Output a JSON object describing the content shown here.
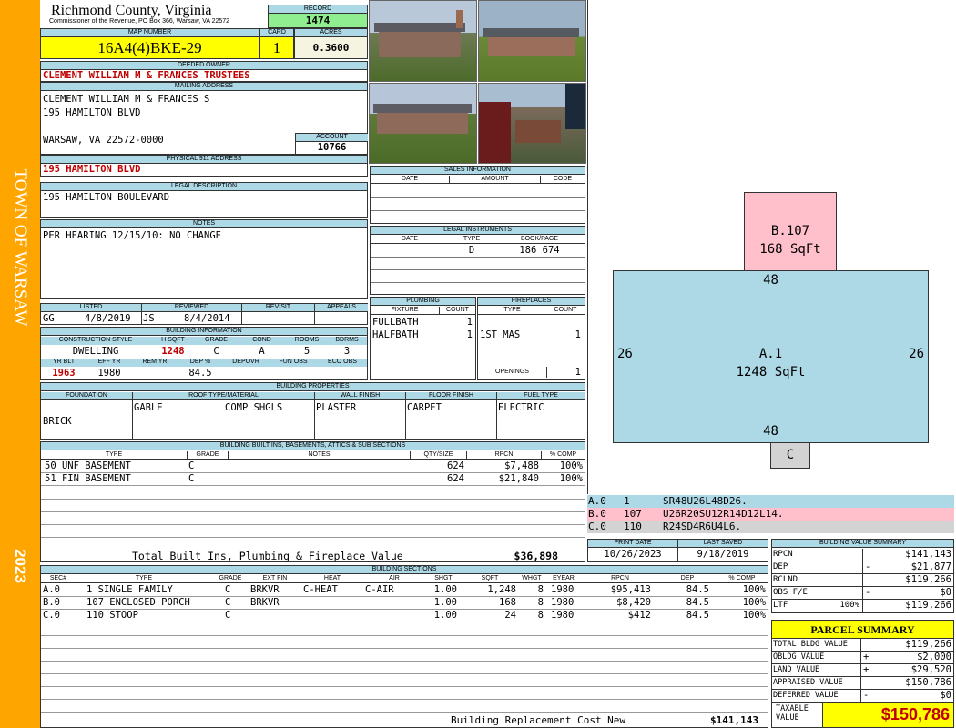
{
  "sidebar": {
    "town": "TOWN OF WARSAW",
    "year": "2023"
  },
  "header": {
    "county": "Richmond County, Virginia",
    "commissioner": "Commissioner of the Revenue, PO Box 366, Warsaw, VA 22572",
    "record_label": "RECORD",
    "record": "1474",
    "map_label": "MAP NUMBER",
    "map_number": "16A4(4)BKE-29",
    "card_label": "CARD",
    "card": "1",
    "acres_label": "ACRES",
    "acres": "0.3600"
  },
  "owner": {
    "deeded_label": "DEEDED OWNER",
    "deeded": "CLEMENT WILLIAM M & FRANCES TRUSTEES",
    "mailing_label": "MAILING ADDRESS",
    "mail1": "CLEMENT WILLIAM M & FRANCES S",
    "mail2": "195 HAMILTON BLVD",
    "mail3": "WARSAW, VA 22572-0000",
    "account_label": "ACCOUNT",
    "account": "10766",
    "physical_label": "PHYSICAL 911 ADDRESS",
    "physical": "195 HAMILTON BLVD",
    "legal_label": "LEGAL DESCRIPTION",
    "legal": "195 HAMILTON BOULEVARD",
    "notes_label": "NOTES",
    "notes": "PER HEARING 12/15/10: NO CHANGE"
  },
  "review": {
    "listed_label": "LISTED",
    "reviewed_label": "REVIEWED",
    "revisit_label": "REVISIT",
    "appeals_label": "APPEALS",
    "listed_by": "GG",
    "listed_date": "4/8/2019",
    "reviewed_by": "JS",
    "reviewed_date": "8/4/2014"
  },
  "building_info": {
    "title": "BUILDING INFORMATION",
    "h1": [
      "CONSTRUCTION STYLE",
      "H SQFT",
      "GRADE",
      "COND",
      "ROOMS",
      "BDRMS"
    ],
    "v1": [
      "DWELLING",
      "1248",
      "C",
      "A",
      "5",
      "3"
    ],
    "h2": [
      "YR BLT",
      "EFF YR",
      "REM YR",
      "DEP %",
      "DEPOVR",
      "FUN OBS",
      "ECO OBS"
    ],
    "v2": [
      "1963",
      "1980",
      "",
      "84.5",
      "",
      "",
      ""
    ]
  },
  "sales": {
    "title": "SALES INFORMATION",
    "headers": [
      "DATE",
      "AMOUNT",
      "CODE"
    ]
  },
  "legal_instruments": {
    "title": "LEGAL INSTRUMENTS",
    "headers": [
      "DATE",
      "TYPE",
      "BOOK/PAGE"
    ],
    "type": "D",
    "bookpage": "186 674"
  },
  "plumbing": {
    "title": "PLUMBING",
    "headers": [
      "FIXTURE",
      "COUNT"
    ],
    "rows": [
      [
        "FULLBATH",
        "1"
      ],
      [
        "HALFBATH",
        "1"
      ]
    ]
  },
  "fireplaces": {
    "title": "FIREPLACES",
    "headers": [
      "TYPE",
      "COUNT"
    ],
    "rows": [
      [
        "1ST MAS",
        "1"
      ]
    ],
    "openings_label": "OPENINGS",
    "openings": "1"
  },
  "properties": {
    "title": "BUILDING PROPERTIES",
    "headers": [
      "FOUNDATION",
      "ROOF TYPE/MATERIAL",
      "WALL FINISH",
      "FLOOR FINISH",
      "FUEL TYPE"
    ],
    "foundation": "BRICK",
    "roof_type": "GABLE",
    "roof_material": "COMP SHGLS",
    "wall": "PLASTER",
    "floor": "CARPET",
    "fuel": "ELECTRIC"
  },
  "builtins": {
    "title": "BUILDING BUILT INS, BASEMENTS, ATTICS & SUB SECTIONS",
    "headers": [
      "TYPE",
      "GRADE",
      "NOTES",
      "QTY/SIZE",
      "RPCN",
      "% COMP"
    ],
    "rows": [
      [
        "50 UNF BASEMENT",
        "C",
        "",
        "624",
        "$7,488",
        "100%"
      ],
      [
        "51 FIN BASEMENT",
        "C",
        "",
        "624",
        "$21,840",
        "100%"
      ]
    ],
    "total_label": "Total Built Ins, Plumbing & Fireplace Value",
    "total": "$36,898"
  },
  "sections": {
    "title": "BUILDING SECTIONS",
    "headers": [
      "SEC#",
      "TYPE",
      "GRADE",
      "EXT FIN",
      "HEAT",
      "AIR",
      "SHGT",
      "SQFT",
      "WHGT",
      "EYEAR",
      "RPCN",
      "DEP",
      "% COMP"
    ],
    "rows": [
      [
        "A.0",
        "1 SINGLE FAMILY",
        "C",
        "BRKVR",
        "C-HEAT",
        "C-AIR",
        "1.00",
        "1,248",
        "8",
        "1980",
        "$95,413",
        "84.5",
        "100%"
      ],
      [
        "B.0",
        "107 ENCLOSED PORCH",
        "C",
        "BRKVR",
        "",
        "",
        "1.00",
        "168",
        "8",
        "1980",
        "$8,420",
        "84.5",
        "100%"
      ],
      [
        "C.0",
        "110 STOOP",
        "C",
        "",
        "",
        "",
        "1.00",
        "24",
        "8",
        "1980",
        "$412",
        "84.5",
        "100%"
      ]
    ],
    "replacement_label": "Building Replacement Cost New",
    "replacement": "$141,143"
  },
  "sketch": {
    "b_label": "B.107",
    "b_area": "168 SqFt",
    "a_label": "A.1",
    "a_area": "1248 SqFt",
    "c_label": "C",
    "dim_top": "48",
    "dim_bottom": "48",
    "dim_left": "26",
    "dim_right": "26",
    "codes": [
      {
        "sec": "A.0",
        "num": "1",
        "code": "SR48U26L48D26.",
        "color": "#add8e6"
      },
      {
        "sec": "B.0",
        "num": "107",
        "code": "U26R20SU12R14D12L14.",
        "color": "#ffc0cb"
      },
      {
        "sec": "C.0",
        "num": "110",
        "code": "R24SD4R6U4L6.",
        "color": "#d3d3d3"
      }
    ]
  },
  "dates": {
    "print_label": "PRINT DATE",
    "print": "10/26/2023",
    "saved_label": "LAST SAVED",
    "saved": "9/18/2019"
  },
  "value_summary": {
    "title": "BUILDING VALUE SUMMARY",
    "rows": [
      {
        "label": "RPCN",
        "pct": "",
        "sign": "",
        "value": "$141,143"
      },
      {
        "label": "DEP",
        "pct": "",
        "sign": "-",
        "value": "$21,877"
      },
      {
        "label": "RCLND",
        "pct": "",
        "sign": "",
        "value": "$119,266"
      },
      {
        "label": "OBS F/E",
        "pct": "",
        "sign": "-",
        "value": "$0"
      },
      {
        "label": "LTF",
        "pct": "100%",
        "sign": "",
        "value": "$119,266"
      }
    ]
  },
  "parcel": {
    "title": "PARCEL SUMMARY",
    "rows": [
      {
        "label": "TOTAL BLDG VALUE",
        "sign": "",
        "value": "$119,266"
      },
      {
        "label": "OBLDG VALUE",
        "sign": "+",
        "value": "$2,000"
      },
      {
        "label": "LAND VALUE",
        "sign": "+",
        "value": "$29,520"
      },
      {
        "label": "APPRAISED VALUE",
        "sign": "",
        "value": "$150,786"
      },
      {
        "label": "DEFERRED VALUE",
        "sign": "-",
        "value": "$0"
      }
    ],
    "taxable_label": "TAXABLE VALUE",
    "taxable": "$150,786"
  },
  "colors": {
    "sidebar": "#ffa500",
    "header_blue": "#add8e6",
    "yellow": "#ffff00",
    "record_green": "#90ee90",
    "red": "#c00000"
  }
}
